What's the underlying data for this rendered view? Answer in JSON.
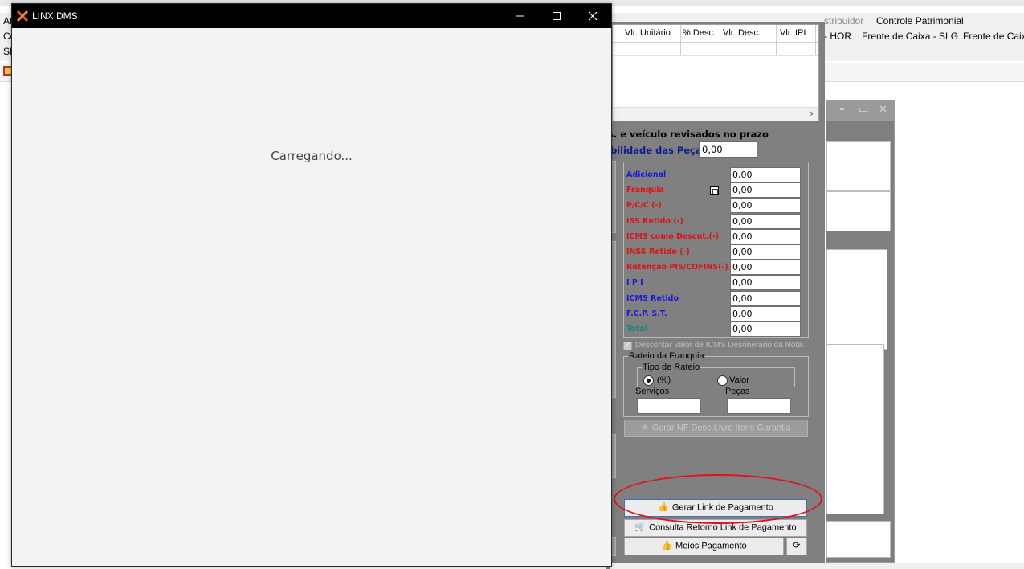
{
  "background_app": {
    "menu_top": [
      "stribuidor",
      "Controle Patrimonial"
    ],
    "menu_second": [
      "- HOR",
      "Frente de Caixa - SLG",
      "Frente de Caixa"
    ],
    "left_letters": [
      "At",
      "Cc",
      "Sh"
    ],
    "grid_headers": [
      "Vlr. Unitário",
      "% Desc.",
      "Vlr. Desc.",
      "Vlr. IPI"
    ],
    "revisados_text": "s. e veículo revisados no prazo",
    "rentabilidade_label": "bilidade das Peças",
    "rentabilidade_value": "0,00",
    "values": [
      {
        "label": "Adicional",
        "value": "0,00",
        "color": "#1a1ad6"
      },
      {
        "label": "Franquia",
        "value": "0,00",
        "color": "#e01010"
      },
      {
        "label": "P/C/C (-)",
        "value": "0,00",
        "color": "#e01010"
      },
      {
        "label": "ISS Retido (-)",
        "value": "0,00",
        "color": "#e01010"
      },
      {
        "label": "ICMS como Descnt.(-)",
        "value": "0,00",
        "color": "#e01010"
      },
      {
        "label": "INSS Retido (-)",
        "value": "0,00",
        "color": "#e01010"
      },
      {
        "label": "Retenção PIS/COFINS(-)",
        "value": "0,00",
        "color": "#e01010"
      },
      {
        "label": "I P I",
        "value": "0,00",
        "color": "#1a1ad6"
      },
      {
        "label": "ICMS Retido",
        "value": "0,00",
        "color": "#1a1ad6"
      },
      {
        "label": "F.C.P.  S.T.",
        "value": "0,00",
        "color": "#1a1ad6"
      },
      {
        "label": "Total",
        "value": "0,00",
        "color": "#0e8a7a"
      }
    ],
    "descontar_label": "Descontar Valor de ICMS Desonerado da Nota.",
    "rateio_legend": "Rateio da Franquia",
    "tipo_rateio_legend": "Tipo de Rateio",
    "radio_percent": "(%)",
    "radio_valor": "Valor",
    "servicos_label": "Serviços",
    "pecas_label": "Peças",
    "btn_gerar_nf": "Gerar NF Desc.Livre Itens Garantia",
    "btn_gerar_link": "Gerar Link de Pagamento",
    "btn_consulta": "Consulta Retorno Link de Pagamento",
    "btn_meios": "Meios Pagamento"
  },
  "dialog": {
    "title": "LINX DMS",
    "loading_text": "Carregando..."
  },
  "colors": {
    "panel_gray": "#808080",
    "highlight_red": "#e0121e",
    "dialog_bg": "#f3f3f4",
    "dialog_titlebar": "#000000"
  }
}
